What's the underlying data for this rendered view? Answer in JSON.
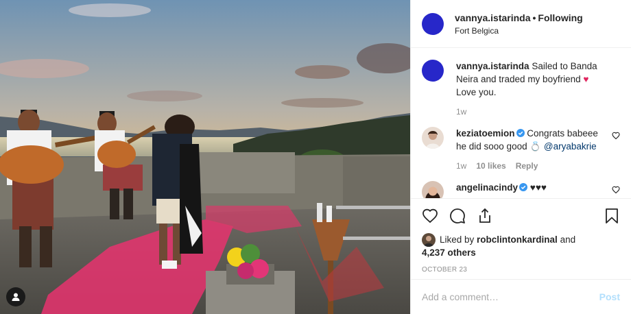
{
  "post": {
    "author": "vannya.istarinda",
    "follow_state": "Following",
    "separator": "•",
    "location": "Fort Belgica",
    "photo_icon": "user-tag-icon"
  },
  "comments": [
    {
      "author": "vannya.istarinda",
      "text_before": "Sailed to Banda Neira and traded my boyfriend ",
      "emoji": "♥",
      "text_after": " Love you.",
      "time": "1w"
    },
    {
      "author": "keziatoemion",
      "verified": true,
      "text": "Congrats babeee he did sooo good 💍 ",
      "mention": "@aryabakrie",
      "time": "1w",
      "likes": "10 likes",
      "reply": "Reply"
    },
    {
      "author": "angelinacindy",
      "verified": true,
      "text": "♥♥♥"
    }
  ],
  "likes": {
    "prefix": "Liked by ",
    "user": "robclintonkardinal",
    "connector": " and",
    "count": "4,237 others"
  },
  "date": "OCTOBER 23",
  "add_comment": {
    "placeholder": "Add a comment…",
    "post_label": "Post"
  },
  "colors": {
    "accent_blue": "#0095f6",
    "post_disabled": "#b2dffc",
    "avatar_blue": "#2727c9",
    "heart_red": "#e0245e",
    "verified_blue": "#3897f0"
  }
}
